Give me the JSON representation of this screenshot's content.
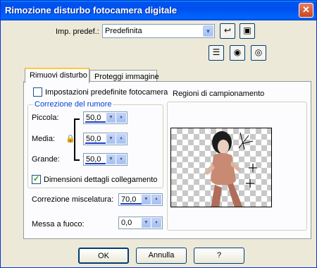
{
  "window": {
    "title": "Rimozione disturbo fotocamera digitale"
  },
  "preset": {
    "label": "Imp. predef.:",
    "value": "Predefinita"
  },
  "tabs": [
    {
      "label": "Rimuovi disturbo"
    },
    {
      "label": "Proteggi immagine"
    }
  ],
  "defaults_checkbox": {
    "label": "Impostazioni predefinite fotocamera",
    "checked": false
  },
  "noise_group": {
    "title": "Correzione del rumore",
    "rows": [
      {
        "label": "Piccola:",
        "value": "50,0",
        "level": 0.5
      },
      {
        "label": "Media:",
        "value": "50,0",
        "level": 0.5
      },
      {
        "label": "Grande:",
        "value": "50,0",
        "level": 0.5
      }
    ],
    "link_checkbox": {
      "label": "Dimensioni dettagli collegamento",
      "checked": true
    }
  },
  "blend": {
    "label": "Correzione miscelatura:",
    "value": "70,0",
    "level": 0.7
  },
  "sharpen": {
    "label": "Messa a fuoco:",
    "value": "0,0",
    "level": 0
  },
  "sampling": {
    "label": "Regioni di campionamento"
  },
  "buttons": {
    "ok": "OK",
    "cancel": "Annulla",
    "help": "?"
  }
}
